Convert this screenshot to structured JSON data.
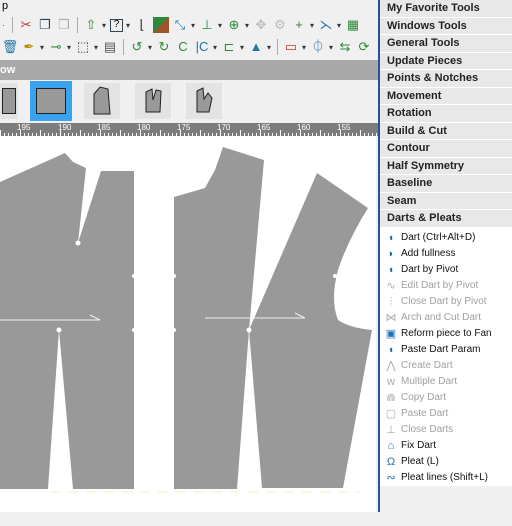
{
  "menubar": {
    "partial_label": "p"
  },
  "window": {
    "title_partial": "ow"
  },
  "ruler": {
    "labels": [
      "195",
      "190",
      "185",
      "180",
      "175",
      "170",
      "165",
      "160",
      "155"
    ]
  },
  "toolbar1": {
    "icons": [
      "cut-icon",
      "copy-icon",
      "paste-icon",
      "import-icon",
      "help-icon",
      "curve-icon",
      "piece-color-icon",
      "measure-icon",
      "notch-icon",
      "add-point-icon",
      "move-point-icon",
      "rotate-icon",
      "intersect-icon",
      "mirror-icon",
      "grade-icon"
    ]
  },
  "toolbar2": {
    "icons": [
      "delete-icon",
      "pen-icon",
      "point-on-line-icon",
      "new-piece-icon",
      "frame-icon",
      "rotate-left-icon",
      "rotate-right-icon",
      "flip-icon",
      "contour-icon",
      "seam-icon",
      "triangle-icon",
      "baseline-icon",
      "split-icon",
      "align-icon",
      "refresh-icon"
    ]
  },
  "thumbnails": [
    {
      "name": "piece-1"
    },
    {
      "name": "rectangle",
      "selected": true
    },
    {
      "name": "pentagon"
    },
    {
      "name": "front-back"
    },
    {
      "name": "bodice"
    }
  ],
  "panel": {
    "headers": [
      "My Favorite Tools",
      "Windows Tools",
      "General Tools",
      "Update Pieces",
      "Points & Notches",
      "Movement",
      "Rotation",
      "Build & Cut",
      "Contour",
      "Half Symmetry",
      "Baseline",
      "Seam",
      "Darts & Pleats"
    ],
    "items": [
      {
        "label": "Dart (Ctrl+Alt+D)",
        "enabled": true,
        "icon": "dart-icon"
      },
      {
        "label": "Add fullness",
        "enabled": true,
        "icon": "add-fullness-icon"
      },
      {
        "label": "Dart by Pivot",
        "enabled": true,
        "icon": "dart-pivot-icon"
      },
      {
        "label": "Edit Dart by Pivot",
        "enabled": false,
        "icon": "edit-dart-pivot-icon"
      },
      {
        "label": "Close Dart by Pivot",
        "enabled": false,
        "icon": "close-dart-pivot-icon"
      },
      {
        "label": "Arch and Cut Dart",
        "enabled": false,
        "icon": "arch-cut-dart-icon"
      },
      {
        "label": "Reform piece to Fan",
        "enabled": true,
        "icon": "fan-icon"
      },
      {
        "label": "Paste Dart Param",
        "enabled": true,
        "icon": "paste-param-icon"
      },
      {
        "label": "Create Dart",
        "enabled": false,
        "icon": "create-dart-icon"
      },
      {
        "label": "Multiple Dart",
        "enabled": false,
        "icon": "multiple-dart-icon"
      },
      {
        "label": "Copy Dart",
        "enabled": false,
        "icon": "copy-dart-icon"
      },
      {
        "label": "Paste Dart",
        "enabled": false,
        "icon": "paste-dart-icon"
      },
      {
        "label": "Close Darts",
        "enabled": false,
        "icon": "close-darts-icon"
      },
      {
        "label": "Fix Dart",
        "enabled": true,
        "icon": "fix-dart-icon"
      },
      {
        "label": "Pleat (L)",
        "enabled": true,
        "icon": "pleat-icon"
      },
      {
        "label": "Pleat lines (Shift+L)",
        "enabled": true,
        "icon": "pleat-lines-icon"
      }
    ]
  },
  "colors": {
    "piece": "#999999",
    "selection": "#3ba2f0",
    "panel_border": "#2b4fa0"
  }
}
